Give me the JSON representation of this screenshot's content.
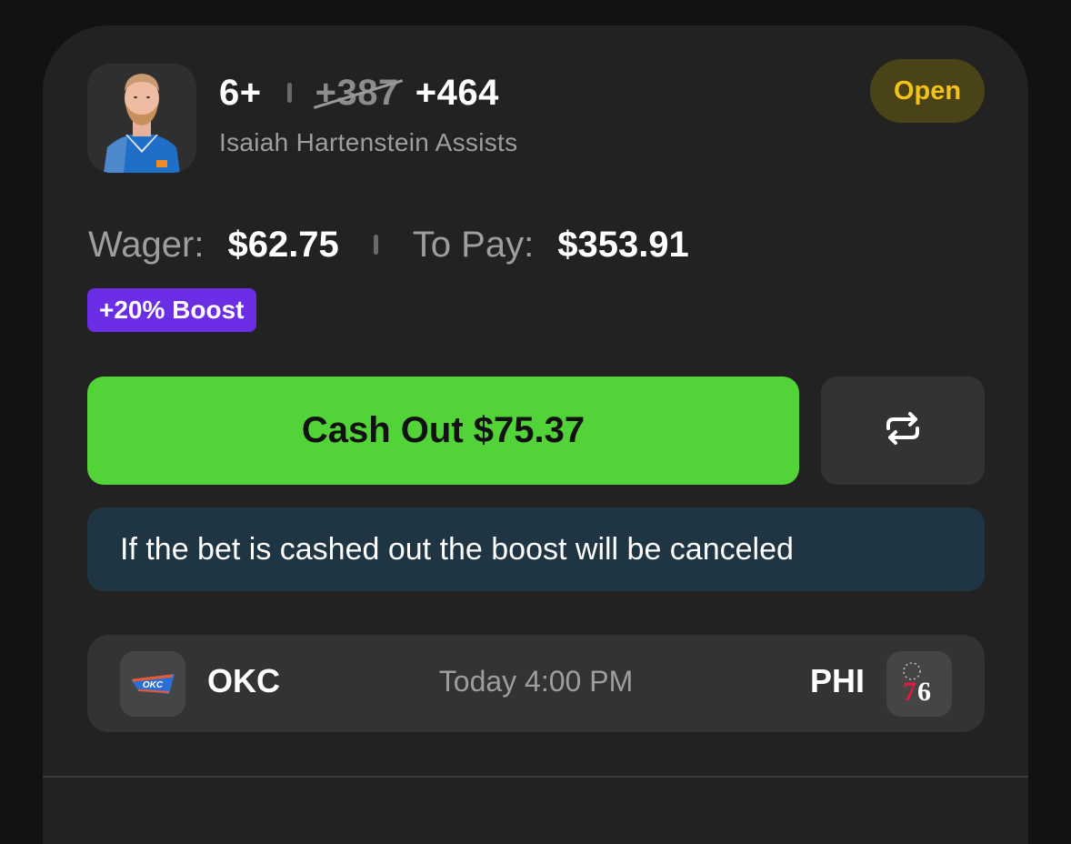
{
  "bet": {
    "line": "6+",
    "old_odds": "+387",
    "new_odds": "+464",
    "market": "Isaiah Hartenstein Assists",
    "status": "Open"
  },
  "wager": {
    "wager_label": "Wager:",
    "wager_value": "$62.75",
    "pay_label": "To Pay:",
    "pay_value": "$353.91"
  },
  "boost_badge": "+20% Boost",
  "cashout_label": "Cash Out $75.37",
  "notice": "If the bet is cashed out the boost will be canceled",
  "game": {
    "away": "OKC",
    "home": "PHI",
    "time": "Today 4:00 PM"
  },
  "icons": {
    "refresh": "repeat-arrows-icon",
    "away_logo": "okc-thunder-logo",
    "home_logo": "philadelphia-76ers-logo"
  },
  "colors": {
    "cashout_green": "#52d337",
    "boost_purple": "#6c2de6",
    "status_yellow": "#f2c21a",
    "notice_bg": "#1f3544"
  }
}
